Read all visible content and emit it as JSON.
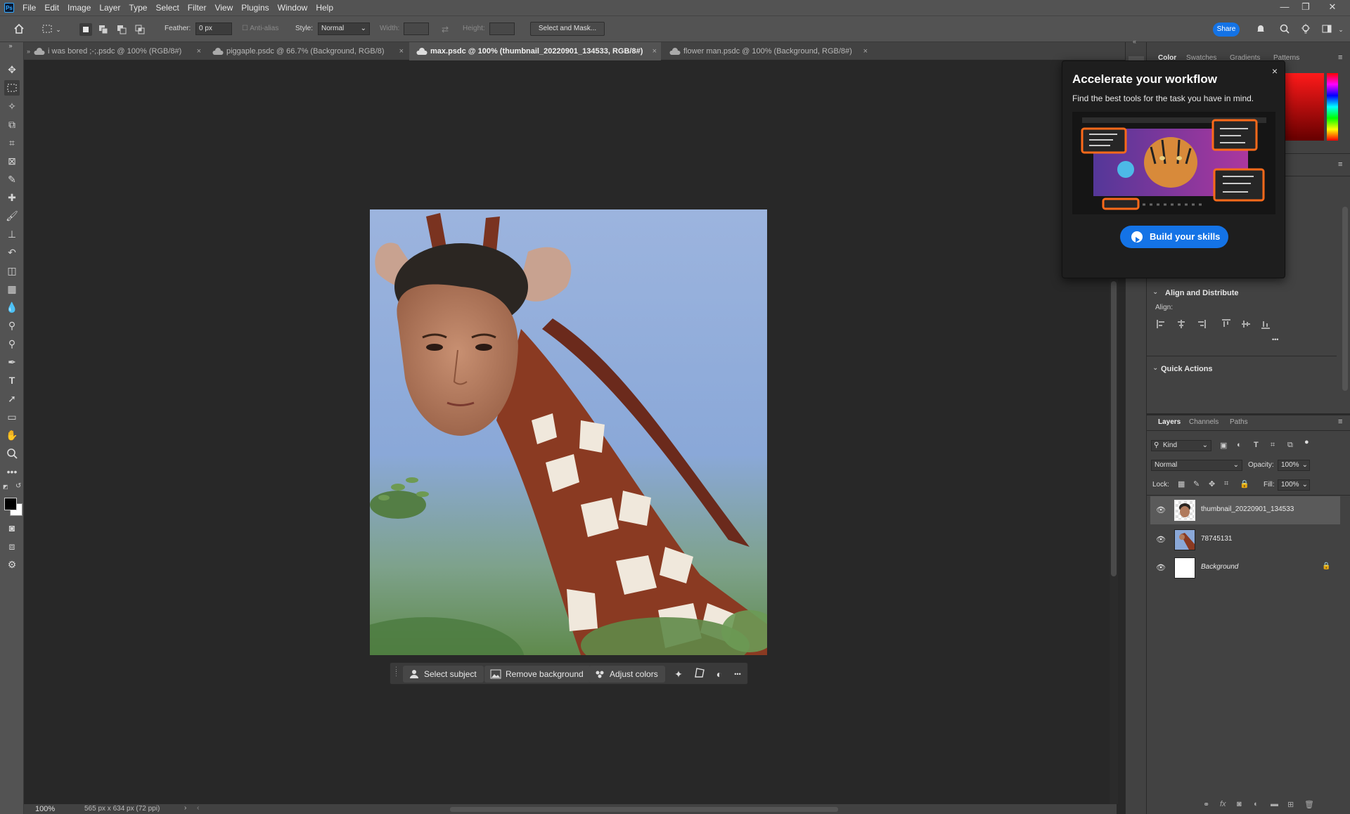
{
  "app": {
    "logo": "Ps"
  },
  "menu": [
    "File",
    "Edit",
    "Image",
    "Layer",
    "Type",
    "Select",
    "Filter",
    "View",
    "Plugins",
    "Window",
    "Help"
  ],
  "window_controls": {
    "minimize": "—",
    "restore": "❐",
    "close": "✕"
  },
  "options": {
    "feather_label": "Feather:",
    "feather_value": "0 px",
    "antialias_label": "Anti-alias",
    "style_label": "Style:",
    "style_value": "Normal",
    "width_label": "Width:",
    "height_label": "Height:",
    "select_mask": "Select and Mask...",
    "share": "Share"
  },
  "tabs": [
    {
      "label": "i was bored ;-;.psdc @ 100% (RGB/8#)"
    },
    {
      "label": "piggaple.psdc @ 66.7% (Background, RGB/8)"
    },
    {
      "label": "max.psdc @ 100% (thumbnail_20220901_134533, RGB/8#)"
    },
    {
      "label": "flower man.psdc @ 100% (Background, RGB/8#)"
    }
  ],
  "tab_close": "×",
  "taskbar": {
    "select_subject": "Select subject",
    "remove_background": "Remove background",
    "adjust_colors": "Adjust colors",
    "more": "•••"
  },
  "right_panel": {
    "color_tabs": [
      "Color",
      "Swatches",
      "Gradients",
      "Patterns"
    ],
    "align_title": "Align and Distribute",
    "align_label": "Align:",
    "align_more": "•••",
    "quick_actions": "Quick Actions",
    "layer_tabs": [
      "Layers",
      "Channels",
      "Paths"
    ],
    "kind": "Kind",
    "blend_mode": "Normal",
    "opacity_label": "Opacity:",
    "opacity_value": "100%",
    "lock_label": "Lock:",
    "fill_label": "Fill:",
    "fill_value": "100%"
  },
  "layers": [
    {
      "name": "thumbnail_20220901_134533",
      "selected": true
    },
    {
      "name": "78745131",
      "selected": false
    },
    {
      "name": "Background",
      "selected": false
    }
  ],
  "popup": {
    "title": "Accelerate your workflow",
    "subtitle": "Find the best tools for the task you have in mind.",
    "cta": "Build your skills",
    "close": "×"
  },
  "status": {
    "zoom": "100%",
    "doc_info": "565 px x 634 px (72 ppi)"
  },
  "colors": {
    "accent": "#1473e6",
    "ui_bg": "#535353",
    "panel_bg": "#424242",
    "canvas_bg": "#282828",
    "highlight_orange": "#ff6a1a"
  }
}
